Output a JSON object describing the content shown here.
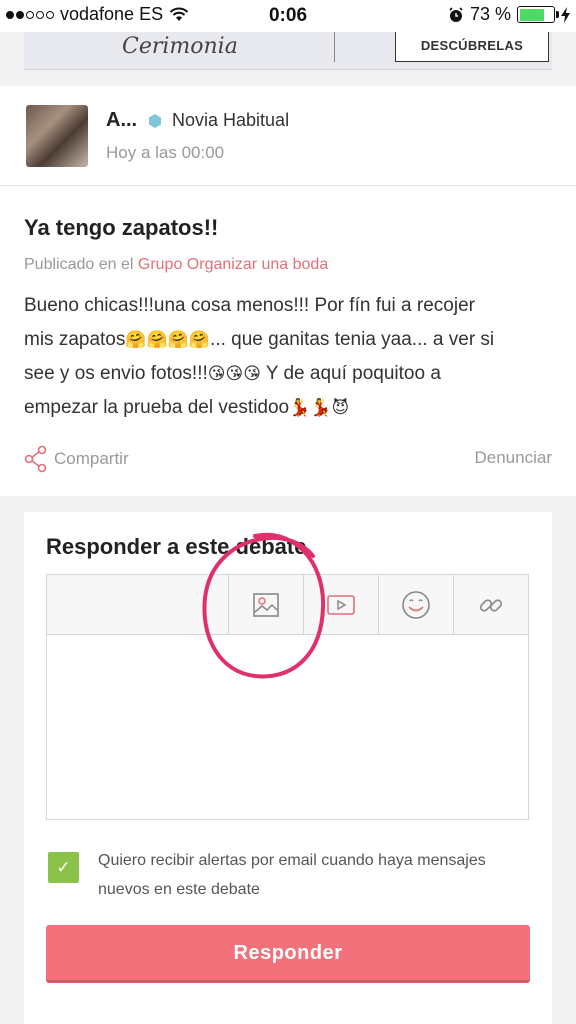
{
  "status_bar": {
    "carrier": "vodafone ES",
    "time": "0:06",
    "battery_percent": "73 %",
    "battery_level": 0.73,
    "icons": [
      "signal-dots-icon",
      "wifi-icon",
      "alarm-icon",
      "battery-icon",
      "charging-icon"
    ]
  },
  "banner": {
    "script_text": "Cerimonia",
    "button_label": "DESCÚBRELAS"
  },
  "post": {
    "author_name": "A...",
    "author_role": "Novia Habitual",
    "timestamp": "Hoy a las 00:00",
    "title": "Ya tengo zapatos!!",
    "published_prefix": "Publicado en el",
    "group_name": "Grupo Organizar una boda",
    "body_lines": [
      "Bueno chicas!!!una cosa menos!!! Por fín fui a recojer",
      "mis zapatos",
      "... que ganitas tenia yaa... a ver si",
      "see y os envio fotos!!!",
      " Y de aquí poquitoo a",
      "empezar la prueba del vestidoo"
    ],
    "share_label": "Compartir",
    "report_label": "Denunciar"
  },
  "reply": {
    "title": "Responder a este debate",
    "toolbar_icons": [
      "image-icon",
      "video-icon",
      "emoji-icon",
      "link-icon"
    ],
    "alert_checked": true,
    "alert_label": "Quiero recibir alertas por email cuando haya mensajes nuevos en este debate",
    "submit_label": "Responder"
  },
  "colors": {
    "accent": "#f2717a",
    "link": "#e2707a",
    "checkbox": "#8bc34a",
    "annotation": "#e0306a"
  }
}
